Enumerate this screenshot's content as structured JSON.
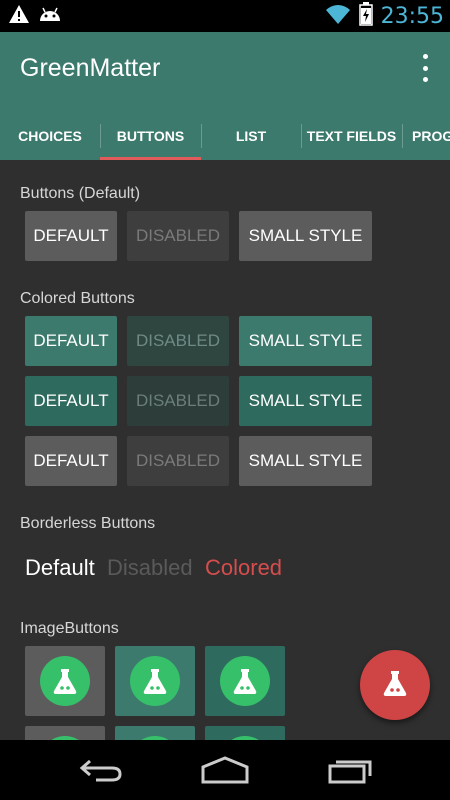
{
  "status_bar": {
    "time": "23:55",
    "icons": [
      "warning-icon",
      "android-icon",
      "wifi-icon",
      "battery-charging-icon"
    ]
  },
  "app": {
    "title": "GreenMatter",
    "colors": {
      "primary": "#3d7a6e",
      "accent": "#e25b5b",
      "background": "#2f2f2f",
      "fab": "#cf4444",
      "icon_green": "#37c06a"
    }
  },
  "tabs": [
    {
      "label": "CHOICES"
    },
    {
      "label": "BUTTONS",
      "active": true
    },
    {
      "label": "LIST"
    },
    {
      "label": "TEXT FIELDS"
    },
    {
      "label": "PROG"
    }
  ],
  "sections": {
    "default_buttons": {
      "title": "Buttons (Default)",
      "buttons": [
        "DEFAULT",
        "DISABLED",
        "SMALL STYLE"
      ]
    },
    "colored_buttons": {
      "title": "Colored Buttons",
      "rows": [
        [
          "DEFAULT",
          "DISABLED",
          "SMALL STYLE"
        ],
        [
          "DEFAULT",
          "DISABLED",
          "SMALL STYLE"
        ],
        [
          "DEFAULT",
          "DISABLED",
          "SMALL STYLE"
        ]
      ]
    },
    "borderless_buttons": {
      "title": "Borderless Buttons",
      "buttons": [
        "Default",
        "Disabled",
        "Colored"
      ]
    },
    "image_buttons": {
      "title": "ImageButtons",
      "icon": "flask-icon"
    }
  },
  "fab": {
    "icon": "flask-icon"
  },
  "nav": {
    "icons": [
      "back-icon",
      "home-icon",
      "recents-icon"
    ]
  }
}
